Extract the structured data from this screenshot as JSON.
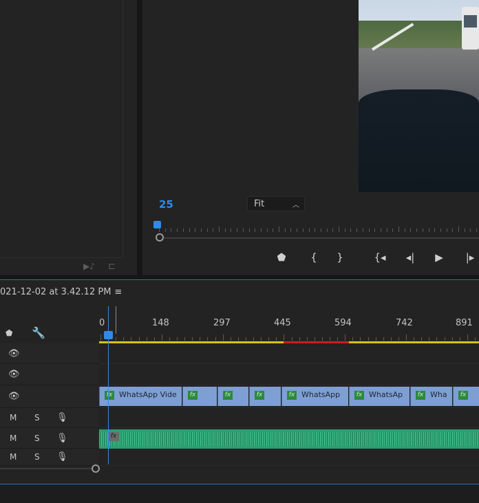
{
  "program_monitor": {
    "timecode": "25",
    "zoom": "Fit",
    "colors": {
      "accent": "#2d8ceb"
    }
  },
  "icons": {
    "left_footer": [
      "export-frame-icon",
      "insert-icon"
    ],
    "transport": [
      "marker-icon",
      "mark-in-icon",
      "mark-out-icon",
      "go-to-in-icon",
      "step-back-icon",
      "play-icon",
      "step-forward-icon"
    ]
  },
  "timeline": {
    "sequence_title": "021-12-02 at 3.42.12 PM",
    "menu_glyph": "≡",
    "ruler_labels": [
      "0",
      "148",
      "297",
      "445",
      "594",
      "742",
      "891"
    ],
    "video_tracks": [
      {
        "icon": "eye-icon"
      },
      {
        "icon": "eye-icon"
      },
      {
        "icon": "eye-icon"
      }
    ],
    "audio_tracks": [
      {
        "mute": "M",
        "solo": "S",
        "icon": "microphone-icon"
      },
      {
        "mute": "M",
        "solo": "S",
        "icon": "microphone-icon"
      },
      {
        "mute": "M",
        "solo": "S",
        "icon": "microphone-icon"
      }
    ],
    "fx_badge": "fx",
    "clips": [
      {
        "label": "WhatsApp Vide"
      },
      {
        "label": ""
      },
      {
        "label": ""
      },
      {
        "label": ""
      },
      {
        "label": "WhatsApp"
      },
      {
        "label": "WhatsAp"
      },
      {
        "label": "Wha"
      },
      {
        "label": ""
      }
    ],
    "colors": {
      "video_clip": "#7e9fd3",
      "audio_clip": "#2c9e70",
      "work_area": "#d4c419",
      "render_red": "#c72020"
    }
  }
}
